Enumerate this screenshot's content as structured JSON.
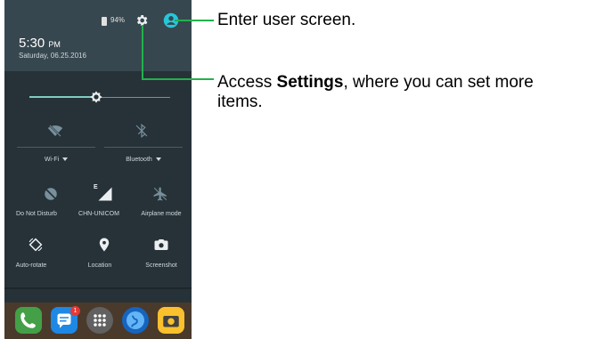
{
  "status_bar": {
    "battery_percent": "94%"
  },
  "header": {
    "time": "5:30",
    "ampm": "PM",
    "date": "Saturday, 06.25.2016"
  },
  "brightness": {
    "level": 0.47
  },
  "quick_settings": {
    "row1": [
      {
        "label": "Wi-Fi",
        "icon": "wifi-off-icon"
      },
      {
        "label": "Bluetooth",
        "icon": "bluetooth-off-icon"
      }
    ],
    "row2": [
      {
        "label": "Do Not Disturb",
        "icon": "do-not-disturb-icon"
      },
      {
        "label": "CHN-UNICOM",
        "icon": "signal-icon",
        "network_type": "E"
      },
      {
        "label": "Airplane mode",
        "icon": "airplane-icon"
      }
    ],
    "row3": [
      {
        "label": "Auto-rotate",
        "icon": "auto-rotate-icon"
      },
      {
        "label": "Location",
        "icon": "location-pin-icon"
      },
      {
        "label": "Screenshot",
        "icon": "camera-icon"
      }
    ]
  },
  "dock": {
    "apps": [
      "phone-app-icon",
      "messages-app-icon",
      "app-drawer-icon",
      "browser-app-icon",
      "camera-app-icon"
    ],
    "message_badge": "1"
  },
  "annotations": {
    "user": {
      "text": "Enter user screen."
    },
    "settings": {
      "prefix": "Access ",
      "emphasis": "Settings",
      "suffix_line1": ", where you can set more",
      "line2": "items."
    }
  },
  "colors": {
    "callout_line": "#22b14c",
    "accent": "#80cbc4",
    "user_icon": "#26c6da",
    "panel_bg": "#263238",
    "header_bg": "#37474f"
  }
}
